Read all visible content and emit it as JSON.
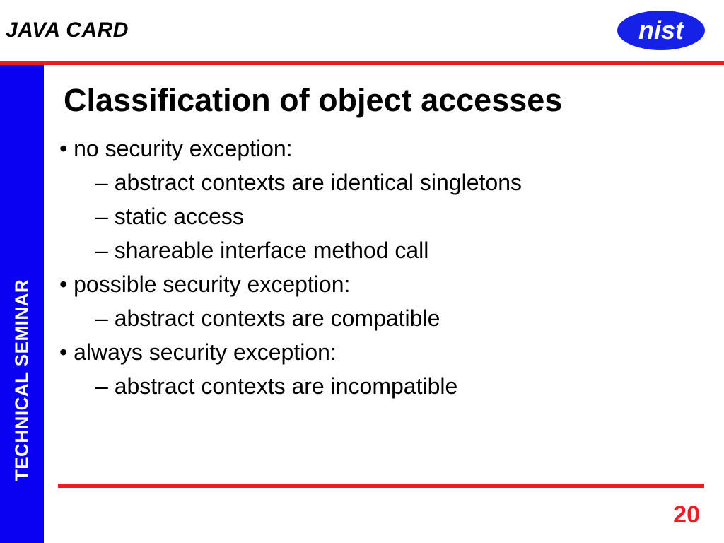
{
  "header": {
    "topic": "JAVA CARD",
    "logo_text": "nist"
  },
  "sidebar": {
    "label": "TECHNICAL   SEMINAR"
  },
  "title": "Classification of object accesses",
  "bullets": [
    {
      "level": 1,
      "text": "no security exception:"
    },
    {
      "level": 2,
      "text": "abstract contexts are identical singletons"
    },
    {
      "level": 2,
      "text": "static access"
    },
    {
      "level": 2,
      "text": "shareable interface method call"
    },
    {
      "level": 1,
      "text": "possible security exception:"
    },
    {
      "level": 2,
      "text": "abstract contexts are compatible"
    },
    {
      "level": 1,
      "text": "always security exception:"
    },
    {
      "level": 2,
      "text": "abstract contexts are incompatible"
    }
  ],
  "page_number": "20",
  "colors": {
    "accent_red": "#ed1c24",
    "sidebar_blue": "#0a00f2",
    "logo_blue": "#1621e8"
  }
}
